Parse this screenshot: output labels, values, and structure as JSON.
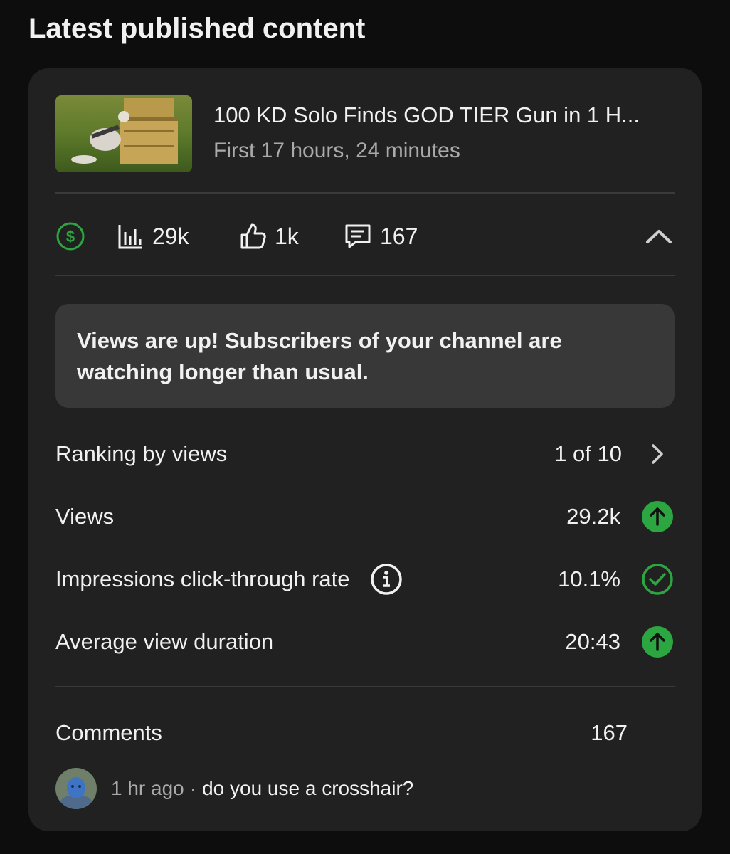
{
  "page": {
    "heading": "Latest published content"
  },
  "video": {
    "title": "100 KD Solo Finds GOD TIER Gun in 1 H...",
    "subtitle": "First 17 hours, 24 minutes"
  },
  "stats": {
    "views": "29k",
    "likes": "1k",
    "comments": "167"
  },
  "insight": {
    "text": "Views are up! Subscribers of your channel are watching longer than usual."
  },
  "metrics": [
    {
      "label": "Ranking by views",
      "value": "1 of 10",
      "status": "chevron-right"
    },
    {
      "label": "Views",
      "value": "29.2k",
      "status": "arrow-up"
    },
    {
      "label": "Impressions click-through rate",
      "value": "10.1%",
      "status": "check"
    },
    {
      "label": "Average view duration",
      "value": "20:43",
      "status": "arrow-up"
    }
  ],
  "comments": {
    "label": "Comments",
    "count": "167",
    "latest": {
      "time": "1 hr ago",
      "separator": "·",
      "text": "do you use a crosshair?"
    }
  },
  "colors": {
    "background": "#0d0d0d",
    "card": "#212121",
    "insight": "#383838",
    "positive": "#2ba640",
    "muted": "#aaaaaa"
  }
}
